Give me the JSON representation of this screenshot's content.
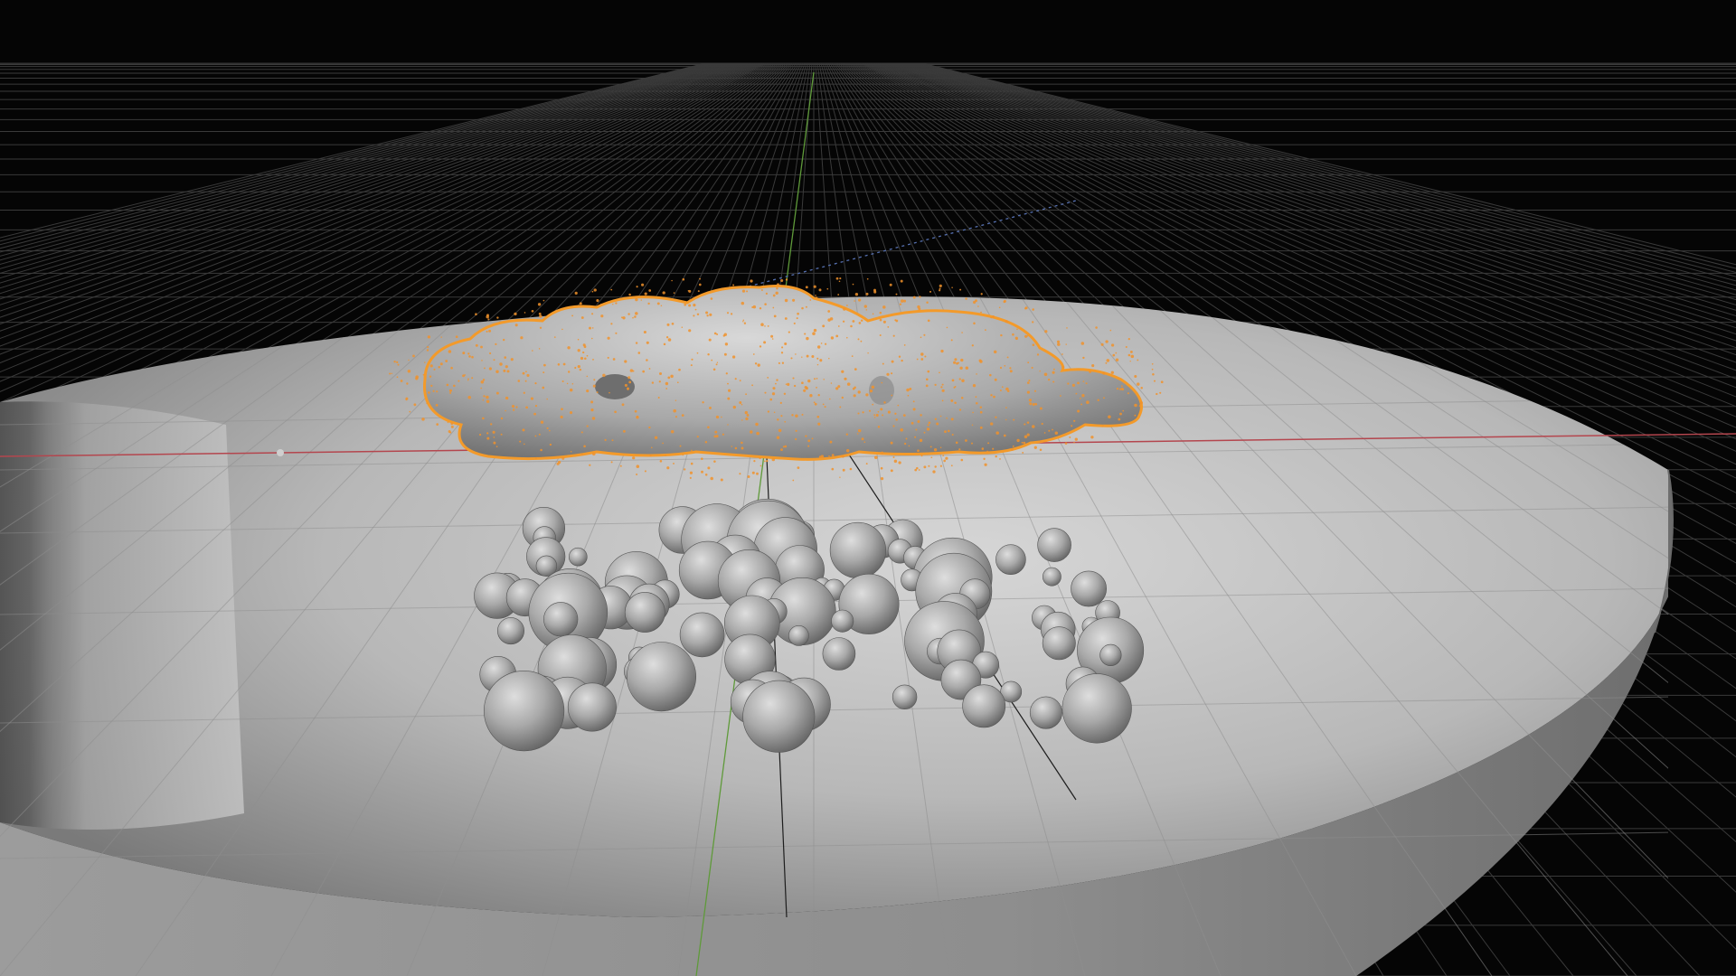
{
  "viewport": {
    "mode": "3d-viewport",
    "shading": "solid",
    "overlays": [
      "floor-grid",
      "x-axis",
      "y-axis"
    ],
    "colors": {
      "background": "#050505",
      "grid": "#3a3a3a",
      "x_axis": "#b4464e",
      "y_axis": "#5f9a3a",
      "bowl_surface": "#bcbcbc",
      "selection_outline": "#f39a2a",
      "particles": "#f0922b",
      "spheres": "#a8a8a8"
    }
  },
  "scene_objects": [
    {
      "name": "bowl",
      "type": "mesh",
      "selected": false
    },
    {
      "name": "cloud-metaball",
      "type": "metaball",
      "selected": true
    },
    {
      "name": "sphere-cluster",
      "type": "mesh",
      "selected": false
    },
    {
      "name": "particle-system",
      "type": "particles",
      "selected": true
    },
    {
      "name": "empty-origin",
      "type": "empty",
      "selected": false
    }
  ]
}
